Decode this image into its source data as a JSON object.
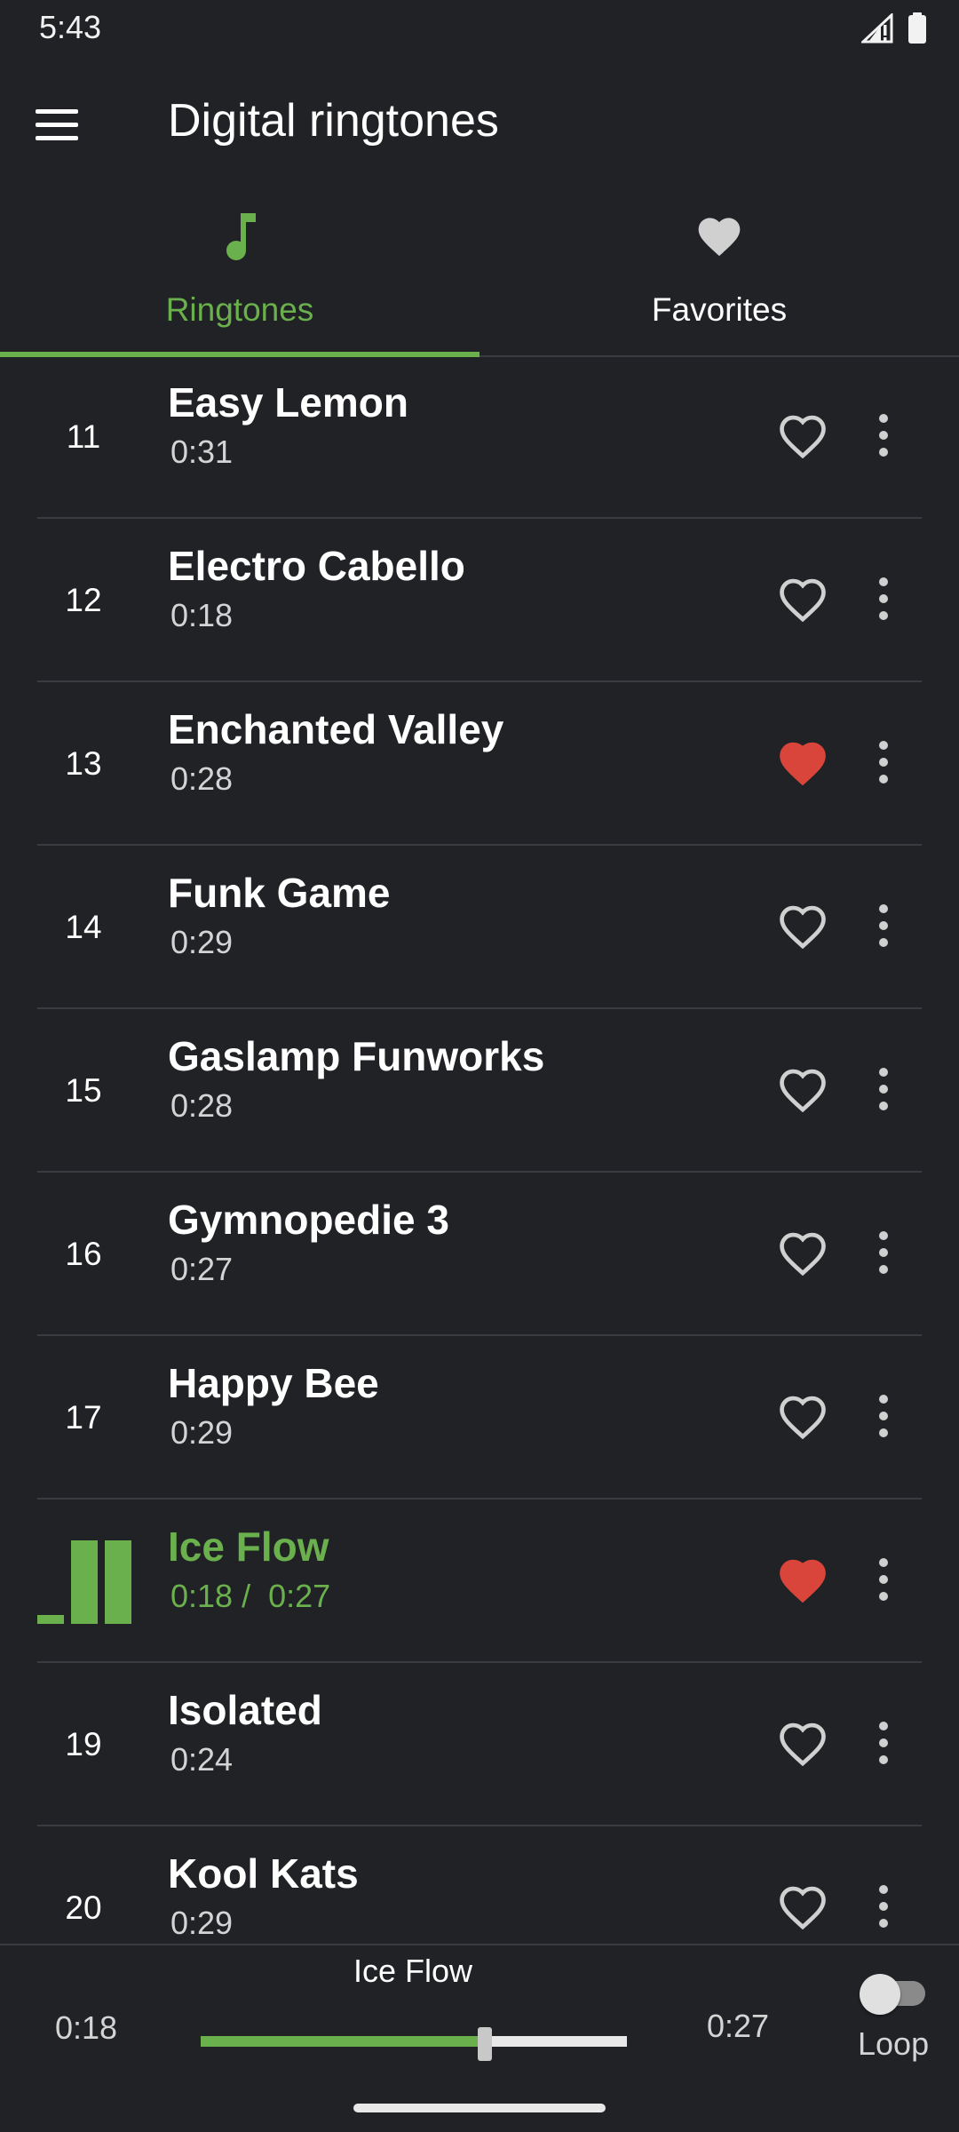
{
  "status_bar": {
    "time": "5:43",
    "icons": [
      "signal-icon",
      "battery-icon"
    ]
  },
  "app_bar": {
    "title": "Digital ringtones",
    "menu_icon": "menu-icon"
  },
  "tabs": [
    {
      "label": "Ringtones",
      "icon": "music-note-icon",
      "active": true
    },
    {
      "label": "Favorites",
      "icon": "heart-icon",
      "active": false
    }
  ],
  "list": {
    "items": [
      {
        "number": "11",
        "title": "Easy Lemon",
        "duration": "0:31",
        "favorite": false,
        "playing": false
      },
      {
        "number": "12",
        "title": "Electro Cabello",
        "duration": "0:18",
        "favorite": false,
        "playing": false
      },
      {
        "number": "13",
        "title": "Enchanted Valley",
        "duration": "0:28",
        "favorite": true,
        "playing": false
      },
      {
        "number": "14",
        "title": "Funk Game",
        "duration": "0:29",
        "favorite": false,
        "playing": false
      },
      {
        "number": "15",
        "title": "Gaslamp Funworks",
        "duration": "0:28",
        "favorite": false,
        "playing": false
      },
      {
        "number": "16",
        "title": "Gymnopedie 3",
        "duration": "0:27",
        "favorite": false,
        "playing": false
      },
      {
        "number": "17",
        "title": "Happy Bee",
        "duration": "0:29",
        "favorite": false,
        "playing": false
      },
      {
        "number": "",
        "title": "Ice Flow",
        "duration": "0:18 /  0:27",
        "favorite": true,
        "playing": true
      },
      {
        "number": "19",
        "title": "Isolated",
        "duration": "0:24",
        "favorite": false,
        "playing": false
      },
      {
        "number": "20",
        "title": "Kool Kats",
        "duration": "0:29",
        "favorite": false,
        "playing": false
      }
    ]
  },
  "player": {
    "title": "Ice Flow",
    "current_time": "0:18",
    "total_time": "0:27",
    "progress": 0.667,
    "loop_label": "Loop",
    "loop_on": false
  },
  "colors": {
    "background": "#212226",
    "accent": "#6ab04c",
    "favorite": "#d9453b",
    "divider": "#3a3b40",
    "icon_inactive": "#d0d0d0"
  }
}
